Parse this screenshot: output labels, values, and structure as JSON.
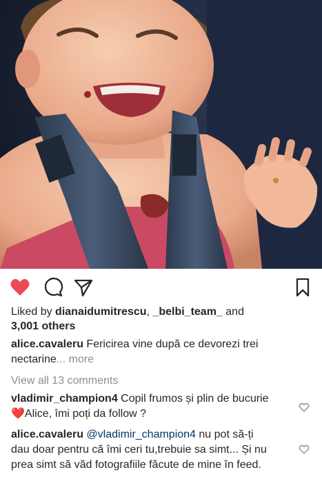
{
  "post": {
    "liked_prefix": "Liked by",
    "liked_user1": "dianaidumitrescu",
    "liked_sep": ",",
    "liked_user2": "_belbi_team_",
    "liked_and": "and",
    "liked_others": "3,001 others",
    "caption_user": "alice.cavaleru",
    "caption_text_line1": "Fericirea vine după ce devorezi trei",
    "caption_text_line2": "nectarine",
    "caption_more": "... more",
    "view_comments": "View all 13 comments"
  },
  "comments": [
    {
      "user": "vladimir_champion4",
      "text_line1": "Copil frumos și plin de bucurie",
      "emoji": "❤️",
      "text_line2": "Alice, îmi poți da follow ?"
    },
    {
      "user": "alice.cavaleru",
      "mention": "@vladimir_champion4",
      "text_line1": "nu pot să-ți",
      "text_line2": "dau doar pentru că îmi ceri tu,trebuie sa simt... Și nu",
      "text_line3": "prea simt să văd fotografiile făcute de mine în feed."
    }
  ],
  "icons": {
    "like": "heart-filled-icon",
    "comment": "comment-icon",
    "share": "paper-plane-icon",
    "save": "bookmark-icon",
    "comment_like": "heart-outline-icon"
  },
  "colors": {
    "like_red": "#ed4956",
    "text": "#262626",
    "muted": "#8e8e8e",
    "link": "#00376b"
  }
}
